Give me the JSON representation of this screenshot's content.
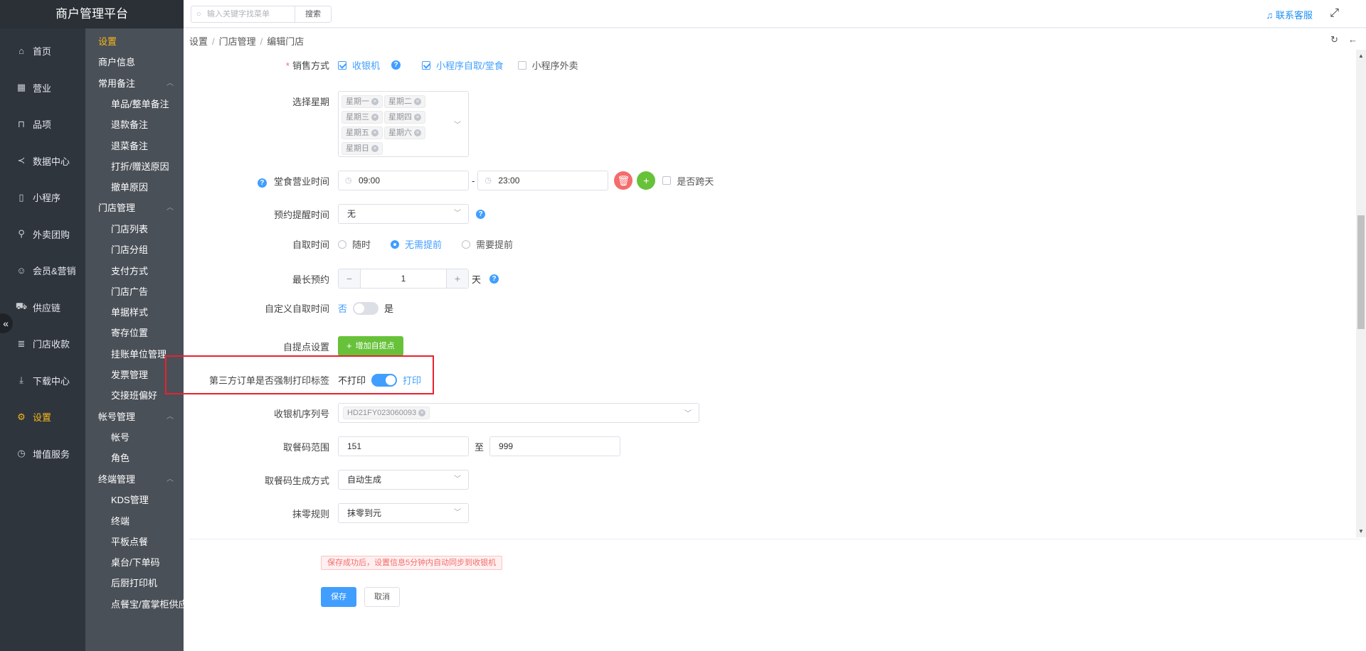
{
  "app": {
    "title": "商户管理平台"
  },
  "primary_nav": [
    {
      "label": "首页",
      "icon": "home-icon"
    },
    {
      "label": "营业",
      "icon": "calendar-icon"
    },
    {
      "label": "品项",
      "icon": "bag-icon"
    },
    {
      "label": "数据中心",
      "icon": "share-icon"
    },
    {
      "label": "小程序",
      "icon": "phone-icon"
    },
    {
      "label": "外卖团购",
      "icon": "bike-icon"
    },
    {
      "label": "会员&营销",
      "icon": "user-icon"
    },
    {
      "label": "供应链",
      "icon": "truck-icon"
    },
    {
      "label": "门店收款",
      "icon": "coins-icon"
    },
    {
      "label": "下载中心",
      "icon": "download-icon"
    },
    {
      "label": "设置",
      "icon": "gear-icon",
      "active": true
    },
    {
      "label": "增值服务",
      "icon": "alarm-icon"
    }
  ],
  "secondary_nav": {
    "title": "设置",
    "merchant_info": "商户信息",
    "groups": {
      "common_notes": "常用备注",
      "store_mgmt": "门店管理",
      "account_mgmt": "帐号管理",
      "terminal_mgmt": "终端管理"
    },
    "common_notes_items": [
      "单品/整单备注",
      "退款备注",
      "退菜备注",
      "打折/赠送原因",
      "撤单原因"
    ],
    "store_items": [
      "门店列表",
      "门店分组",
      "支付方式",
      "门店广告",
      "单据样式",
      "寄存位置",
      "挂账单位管理",
      "发票管理",
      "交接班偏好"
    ],
    "account_items": [
      "帐号",
      "角色"
    ],
    "terminal_items": [
      "KDS管理",
      "终端",
      "平板点餐",
      "桌台/下单码",
      "后厨打印机",
      "点餐宝/富掌柜供应"
    ]
  },
  "topbar": {
    "search_placeholder": "输入关键字找菜单",
    "search_button": "搜索",
    "service": "联系客服"
  },
  "breadcrumb": [
    "设置",
    "门店管理",
    "编辑门店"
  ],
  "form": {
    "sales_mode": {
      "label": "销售方式",
      "options": [
        "收银机",
        "小程序自取/堂食",
        "小程序外卖"
      ]
    },
    "weekdays": {
      "label": "选择星期",
      "tags": [
        "星期一",
        "星期二",
        "星期三",
        "星期四",
        "星期五",
        "星期六",
        "星期日"
      ]
    },
    "dine_hours": {
      "label": "堂食营业时间",
      "start": "09:00",
      "dash": "-",
      "end": "23:00",
      "cross_day": "是否跨天"
    },
    "reminder": {
      "label": "预约提醒时间",
      "value": "无"
    },
    "pickup_time": {
      "label": "自取时间",
      "options": [
        "随时",
        "无需提前",
        "需要提前"
      ]
    },
    "max_booking": {
      "label": "最长预约",
      "value": "1",
      "minus": "−",
      "plus": "+",
      "unit": "天"
    },
    "custom_pickup": {
      "label": "自定义自取时间",
      "off": "否",
      "on": "是"
    },
    "pickup_point": {
      "label": "自提点设置",
      "button": "增加自提点"
    },
    "force_print": {
      "label": "第三方订单是否强制打印标签",
      "off": "不打印",
      "on": "打印"
    },
    "pos_serial": {
      "label": "收银机序列号",
      "tag": "HD21FY023060093"
    },
    "meal_code_range": {
      "label": "取餐码范围",
      "from": "151",
      "to_text": "至",
      "to": "999"
    },
    "meal_code_mode": {
      "label": "取餐码生成方式",
      "value": "自动生成"
    },
    "rounding": {
      "label": "抹零规则",
      "value": "抹零到元"
    }
  },
  "footer": {
    "notice": "保存成功后，设置信息5分钟内自动同步到收银机",
    "save": "保存",
    "cancel": "取消"
  },
  "colors": {
    "accent": "#409eff",
    "active_nav": "#f5b71a",
    "highlight": "#e8222e"
  }
}
